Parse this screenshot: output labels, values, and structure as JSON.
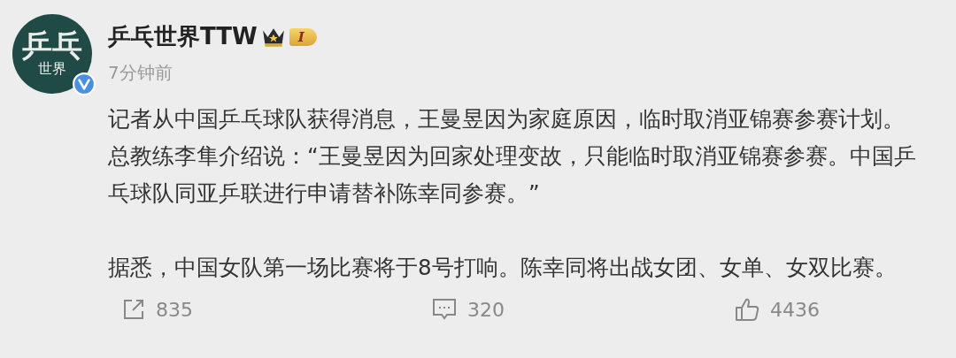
{
  "author": {
    "avatar_text": [
      "乒乓",
      "世界"
    ],
    "verified": true,
    "name": "乒乓世界TTW",
    "level_badge": "I",
    "time": "7分钟前"
  },
  "body": [
    "记者从中国乒乓球队获得消息，王曼昱因为家庭原因，临时取消亚锦赛参赛计划。总教练李隼介绍说：“王曼昱因为回家处理变故，只能临时取消亚锦赛参赛。中国乒乓球队同亚乒联进行申请替补陈幸同参赛。”",
    "据悉，中国女队第一场比赛将于8号打响。陈幸同将出战女团、女单、女双比赛。"
  ],
  "actions": [
    {
      "kind": "share",
      "count": "835"
    },
    {
      "kind": "comment",
      "count": "320"
    },
    {
      "kind": "like",
      "count": "4436"
    }
  ]
}
